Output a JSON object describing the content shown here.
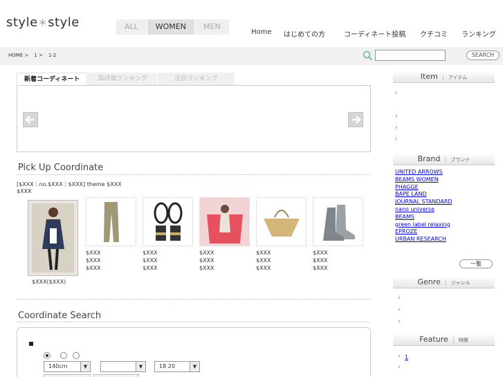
{
  "header": {
    "logo_left": "style",
    "logo_star": "＊",
    "logo_right": "style",
    "gender_tabs": [
      "ALL",
      "WOMEN",
      "MEN"
    ],
    "nav": [
      "Home",
      "はじめての方",
      "コーディネート投稿",
      "クチコミ",
      "ランキング"
    ]
  },
  "breadcrumb": [
    "HOME >",
    "1 >",
    "1-2"
  ],
  "search": {
    "value": "",
    "button_label": "SEARCH"
  },
  "main_tabs": [
    "新着コーディネート",
    "高評価ランキング",
    "注目ランキング"
  ],
  "pickup": {
    "title": "Pick Up Coordinate",
    "meta_line1": "[$XXX｜no.$XXX｜$XXX] theme $XXX",
    "meta_line2": "$XXX",
    "main_price": "$XXX($XXX)",
    "items": [
      {
        "icon": "pants-image",
        "prices": [
          "$XXX",
          "$XXX",
          "$XXX"
        ]
      },
      {
        "icon": "sandals-image",
        "prices": [
          "$XXX",
          "$XXX",
          "$XXX"
        ]
      },
      {
        "icon": "tote-bag-image",
        "prices": [
          "$XXX",
          "$XXX",
          "$XXX"
        ]
      },
      {
        "icon": "basket-bag-image",
        "prices": [
          "$XXX",
          "$XXX",
          "$XXX"
        ]
      },
      {
        "icon": "boots-image",
        "prices": [
          "$XXX",
          "$XXX",
          "$XXX"
        ]
      }
    ]
  },
  "coordinate_search": {
    "title": "Coordinate Search",
    "height_value": "140cm",
    "age_value": "18 20"
  },
  "sidebar": {
    "item": {
      "title": "Item",
      "jp": "アイテム"
    },
    "brand": {
      "title": "Brand",
      "jp": "ブランド",
      "links": [
        "UNITED ARROWS",
        "BEAMS WOMEN",
        "PHAGGE",
        "BAPE LAND",
        "JOURNAL STANDARD",
        "nano universe",
        "BEAMS",
        "green label relaxing",
        "EPROZE",
        "URBAN RESEARCH"
      ],
      "more_label": "一覧"
    },
    "genre": {
      "title": "Genre",
      "jp": "ジャンル"
    },
    "feature": {
      "title": "Feature",
      "jp": "特徴",
      "first_link": "1"
    }
  },
  "colors": {
    "link": "#0000ee",
    "tab_bg": "#efefef",
    "bar_bg": "#f1f1f1"
  }
}
